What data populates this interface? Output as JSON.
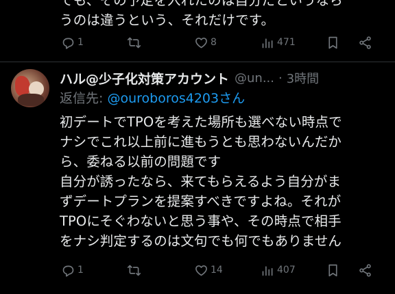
{
  "previous_tweet": {
    "lines": [
      "でも、その予定を入れたのは自分だというなら",
      "うのは違うという、それだけです。"
    ],
    "actions": {
      "reply_count": "1",
      "retweet_count": "",
      "like_count": "8",
      "view_count": "471"
    }
  },
  "reply_tweet": {
    "author_name": "ハル@少子化対策アカウント",
    "author_handle": "@un...",
    "separator": "·",
    "time": "3時間",
    "reply_to_label": "返信先: ",
    "reply_to_target": "@ouroboros4203さん",
    "body_lines": [
      "初デートでTPOを考えた場所も選べない時点で",
      "ナシでこれ以上前に進もうとも思わないんだか",
      "ら、委ねる以前の問題です",
      "自分が誘ったなら、来てもらえるよう自分がま",
      "ずデートプランを提案すべきですよね。それが",
      "TPOにそぐわないと思う事や、その時点で相手",
      "をナシ判定するのは文句でも何でもありません"
    ],
    "actions": {
      "reply_count": "1",
      "retweet_count": "",
      "like_count": "14",
      "view_count": "407"
    }
  },
  "icons": [
    "reply-icon",
    "retweet-icon",
    "like-icon",
    "views-icon",
    "bookmark-icon",
    "share-icon"
  ],
  "colors": {
    "background": "#000000",
    "text": "#e7e9ea",
    "secondary": "#71767b",
    "link": "#1d9bf0",
    "divider": "#2f3336"
  }
}
